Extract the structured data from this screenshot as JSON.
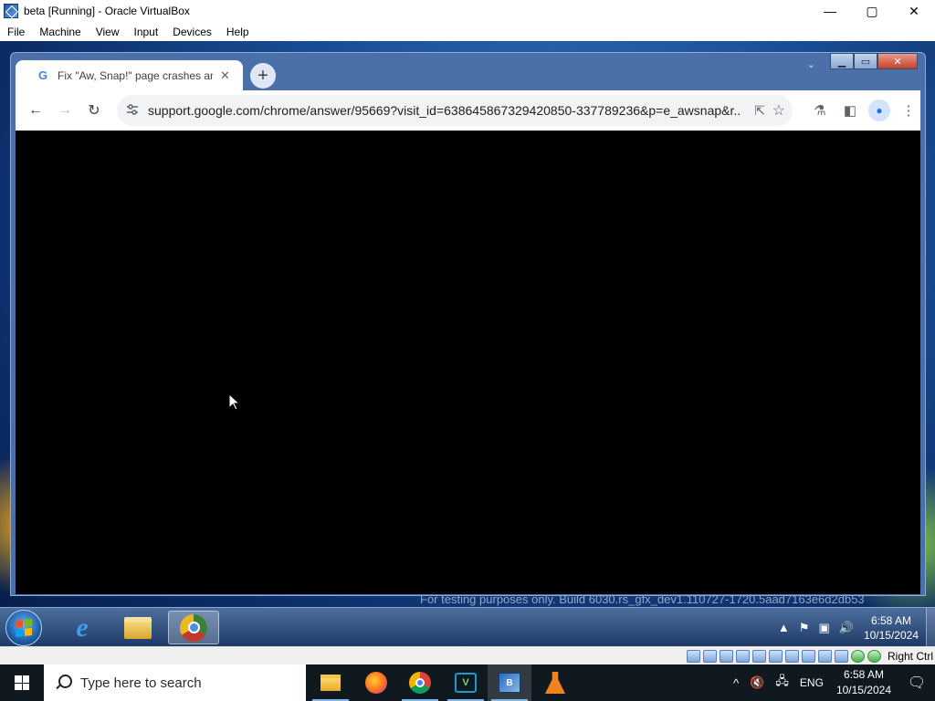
{
  "host_window": {
    "title": "beta [Running] - Oracle VirtualBox",
    "controls": {
      "minimize": "—",
      "maximize": "▢",
      "close": "✕"
    },
    "menu": [
      "File",
      "Machine",
      "View",
      "Input",
      "Devices",
      "Help"
    ]
  },
  "guest": {
    "watermark": "For testing purposes only. Build 6030.rs_gfx_dev1.110727-1720.5aad7163e6d2db53",
    "chrome": {
      "tab": {
        "title": "Fix \"Aw, Snap!\" page crashes and",
        "close": "✕",
        "favicon": "G"
      },
      "new_tab": "+",
      "aero_controls": {
        "minimize": "▁",
        "maximize": "▭",
        "close": "✕"
      },
      "tab_search": "⌄",
      "toolbar": {
        "back": "←",
        "forward": "→",
        "reload": "↻",
        "url": "support.google.com/chrome/answer/95669?visit_id=638645867329420850-337789236&p=e_awsnap&r...",
        "share": "⇱",
        "star": "☆",
        "labs": "⚗",
        "side_panel": "◧",
        "profile": "●",
        "menu": "⋮"
      },
      "content_color": "#000000"
    },
    "taskbar": {
      "tray_icons": [
        "▲",
        "⚑",
        "▣",
        "🔊"
      ],
      "time": "6:58 AM",
      "date": "10/15/2024"
    }
  },
  "vbox_status": {
    "host_key": "Right Ctrl"
  },
  "host_taskbar": {
    "search_placeholder": "Type here to search",
    "tray": {
      "chevron": "^",
      "volume": "🔇",
      "network": "🖧",
      "language": "ENG",
      "notifications": "🗨"
    },
    "time": "6:58 AM",
    "date": "10/15/2024"
  },
  "colors": {
    "guest_wallpaper": "#1a4f96",
    "chrome_frame": "#4b6fa8",
    "host_taskbar": "#101820"
  }
}
